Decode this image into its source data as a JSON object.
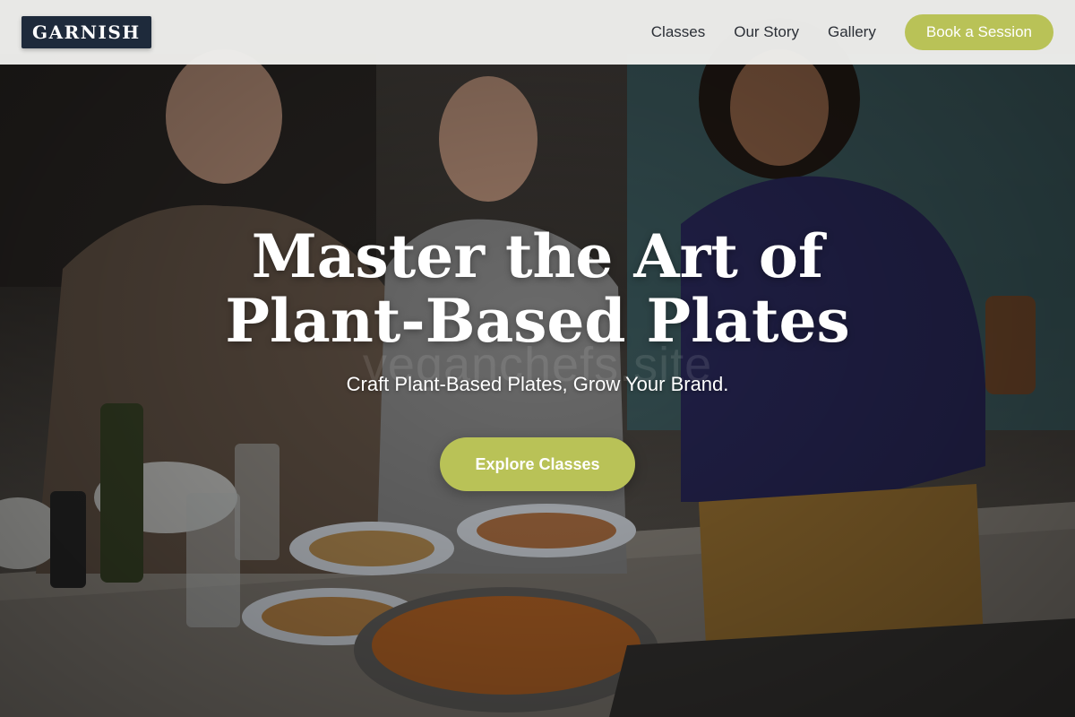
{
  "brand": {
    "logo_text": "GARNISH"
  },
  "nav": {
    "links": [
      {
        "label": "Classes"
      },
      {
        "label": "Our Story"
      },
      {
        "label": "Gallery"
      }
    ],
    "cta_label": "Book a Session"
  },
  "hero": {
    "headline": "Master the Art of Plant-Based Plates",
    "subheadline": "Craft Plant-Based Plates, Grow Your Brand.",
    "watermark": "veganchefs.site",
    "cta_label": "Explore Classes"
  },
  "colors": {
    "accent": "#b9c257",
    "logo_bg": "#1e2a3b",
    "nav_bg": "#f0f0ee",
    "nav_text": "#2b2f36"
  }
}
